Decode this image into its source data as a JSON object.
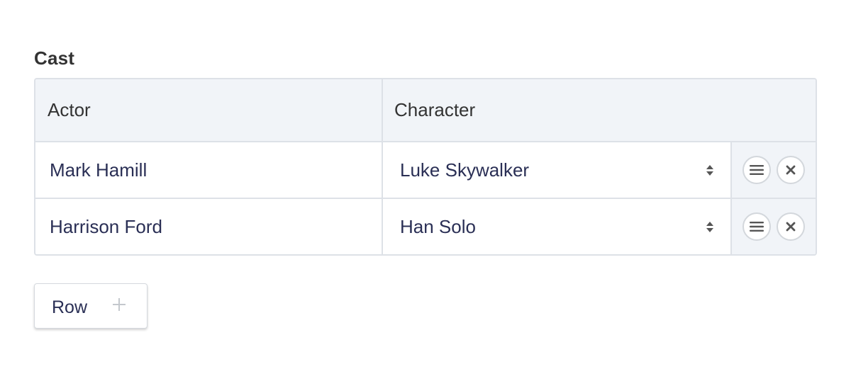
{
  "field": {
    "label": "Cast"
  },
  "table": {
    "columns": [
      "Actor",
      "Character"
    ],
    "rows": [
      {
        "actor": "Mark Hamill",
        "character": "Luke Skywalker"
      },
      {
        "actor": "Harrison Ford",
        "character": "Han Solo"
      }
    ],
    "row_actions": {
      "handle_icon": "hamburger-menu-icon",
      "remove_icon": "close-x-icon"
    }
  },
  "add_row": {
    "label": "Row",
    "icon": "plus-icon"
  },
  "colors": {
    "header_bg": "#f1f4f8",
    "border": "#dde1e7",
    "value_text": "#2a2f55",
    "label_text": "#333333"
  }
}
